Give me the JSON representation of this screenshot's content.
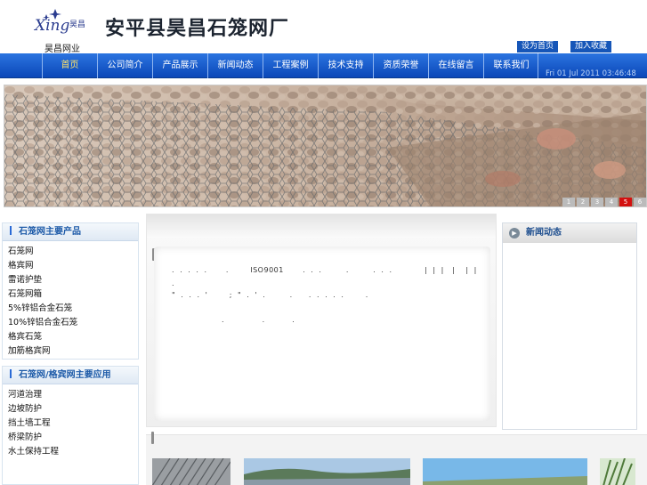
{
  "header": {
    "logo_caption": "昊昌网业",
    "logo_script": "Xing",
    "logo_cn": "昊昌",
    "site_title": "安平县昊昌石笼网厂",
    "set_home_label": "设为首页",
    "add_favorite_label": "加入收藏"
  },
  "nav": {
    "items": [
      {
        "label": "首页"
      },
      {
        "label": "公司简介"
      },
      {
        "label": "产品展示"
      },
      {
        "label": "新闻动态"
      },
      {
        "label": "工程案例"
      },
      {
        "label": "技术支持"
      },
      {
        "label": "资质荣誉"
      },
      {
        "label": "在线留言"
      },
      {
        "label": "联系我们"
      }
    ],
    "date_text": "Fri 01 Jul 2011 03:46:48"
  },
  "banner": {
    "pages": [
      "1",
      "2",
      "3",
      "4",
      "5",
      "6"
    ],
    "active_page": "5"
  },
  "products": {
    "title": "石笼网主要产品",
    "items": [
      "石笼网",
      "格宾网",
      "雷诺护垫",
      "石笼网箱",
      "5%锌铝合金石笼",
      "10%锌铝合金石笼",
      "格宾石笼",
      "加筋格宾网"
    ]
  },
  "applications": {
    "title": "石笼网/格宾网主要应用",
    "items": [
      "河道治理",
      "边坡防护",
      "挡土墙工程",
      "桥梁防护",
      "水土保持工程"
    ]
  },
  "intro": {
    "line1": ".  .  .  .  .       .        ISO9001       .  .  .         .         .  .  .            |  |  |   |    |  |",
    "line2": ".",
    "line3": "\"  .  .  .  '        ;  \"  .  '  .         .      .  .  .  .  .        .",
    "line4": ".              .          ."
  },
  "news": {
    "title": "新闻动态",
    "icon_glyph": "▶"
  }
}
